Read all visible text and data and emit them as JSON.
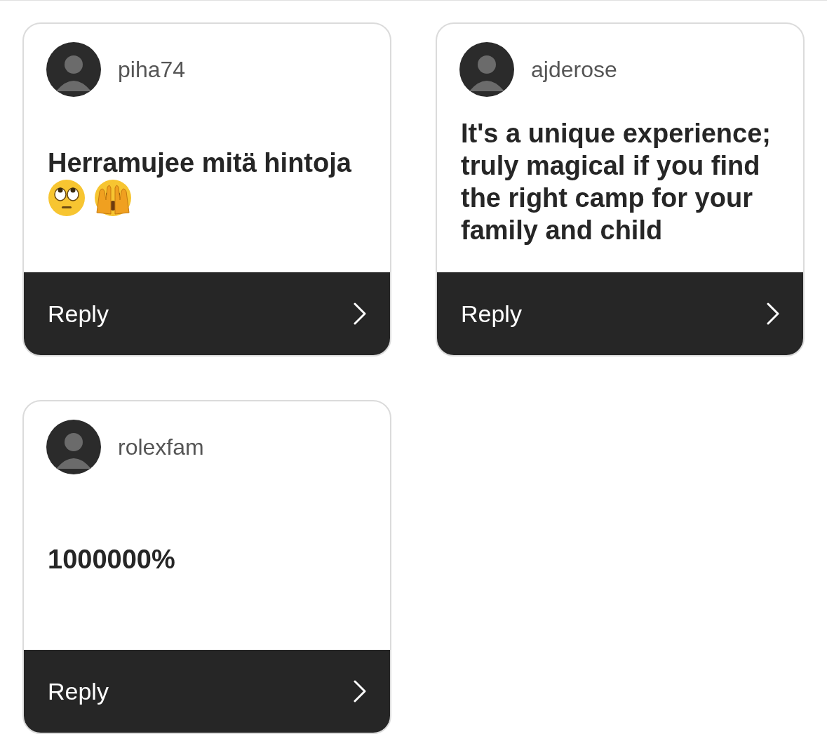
{
  "cards": [
    {
      "username": "piha74",
      "message": "Herramujee mitä hintoja",
      "emojis": [
        {
          "kind": "rolling-eyes"
        },
        {
          "kind": "peeking"
        }
      ],
      "reply": "Reply"
    },
    {
      "username": "ajderose",
      "message": "It's a unique experience; truly magical if you find the right camp for your family and child",
      "reply": "Reply"
    },
    {
      "username": "rolexfam",
      "message": "1000000%",
      "reply": "Reply"
    }
  ]
}
